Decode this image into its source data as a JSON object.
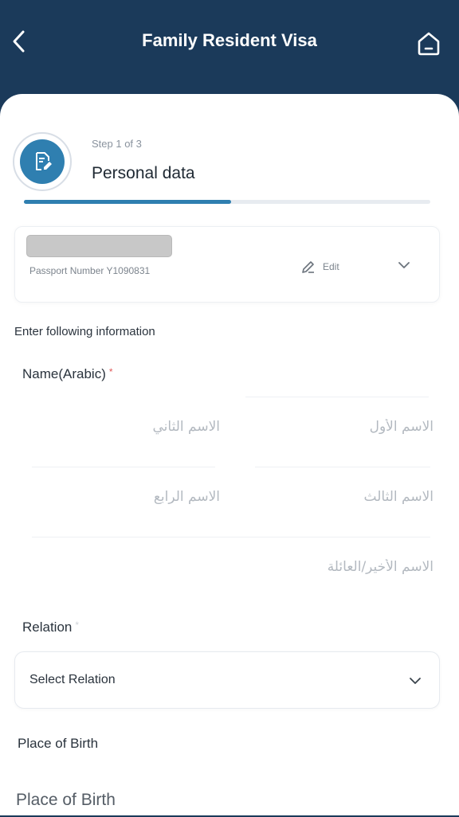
{
  "header": {
    "title": "Family Resident Visa",
    "background_color": "#1b3a5a",
    "back_icon": "chevron-left-icon",
    "home_icon": "home-icon"
  },
  "step": {
    "count": "Step 1 of 3",
    "title": "Personal data",
    "progress": 0.51,
    "icon": "document-edit-icon",
    "accent_color": "#2f7fb0"
  },
  "passport": {
    "number_text": "Passport Number Y1090831",
    "edit_label": "Edit",
    "edit_icon": "pencil-icon",
    "expand_icon": "chevron-down-icon"
  },
  "form": {
    "section_label": "Enter following information",
    "name_arabic": {
      "label": "Name(Arabic)",
      "required_mark": "*",
      "first_name_placeholder": "الاسم الأول",
      "second_name_placeholder": "الاسم الثاني",
      "third_name_placeholder": "الاسم الثالث",
      "fourth_name_placeholder": "الاسم الرابع",
      "family_name_placeholder": "الاسم الأخير/العائلة"
    },
    "relation": {
      "label": "Relation",
      "required_mark": "*",
      "selected": "Select Relation"
    },
    "place_of_birth": {
      "label": "Place of Birth",
      "placeholder": "Place of Birth"
    }
  }
}
